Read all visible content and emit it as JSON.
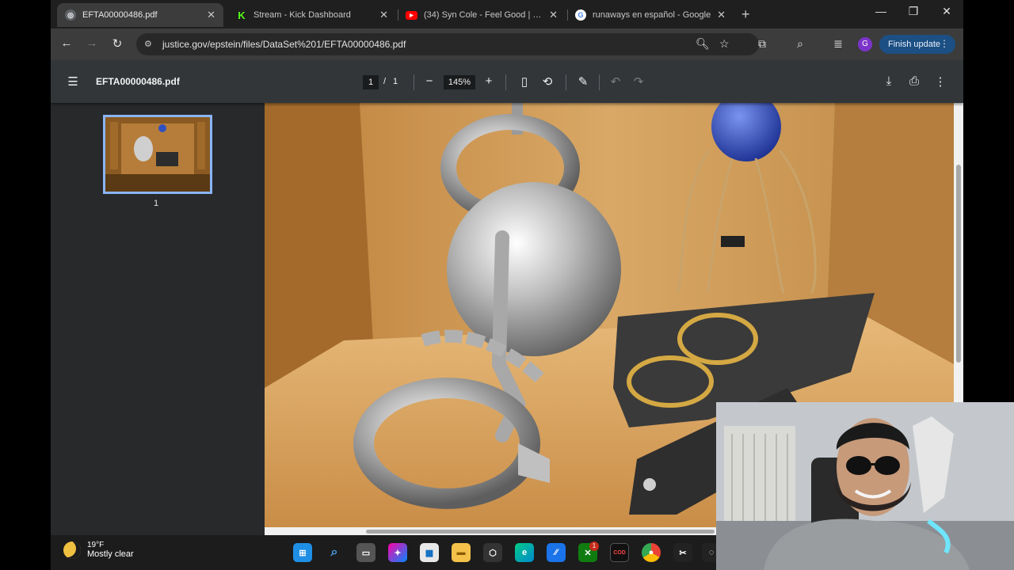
{
  "tabs": [
    {
      "title": "EFTA00000486.pdf",
      "favicon": "globe-icon",
      "active": true
    },
    {
      "title": "Stream - Kick Dashboard",
      "favicon": "kick-icon",
      "active": false
    },
    {
      "title": "(34) Syn Cole - Feel Good | Futu",
      "favicon": "youtube-icon",
      "active": false
    },
    {
      "title": "runaways en español - Google",
      "favicon": "google-icon",
      "active": false
    }
  ],
  "toolbar": {
    "url": "justice.gov/epstein/files/DataSet%201/EFTA00000486.pdf",
    "profile_initial": "G",
    "update_label": "Finish update"
  },
  "pdf": {
    "filename": "EFTA00000486.pdf",
    "current_page": "1",
    "page_separator": "/",
    "total_pages": "1",
    "zoom": "145%",
    "thumbnail_label": "1"
  },
  "taskbar": {
    "temperature": "19°F",
    "condition": "Mostly clear",
    "notification_badge": "1"
  },
  "colors": {
    "accent": "#8ab4f8",
    "update_button": "#1c4f83",
    "profile": "#7b34c9"
  }
}
